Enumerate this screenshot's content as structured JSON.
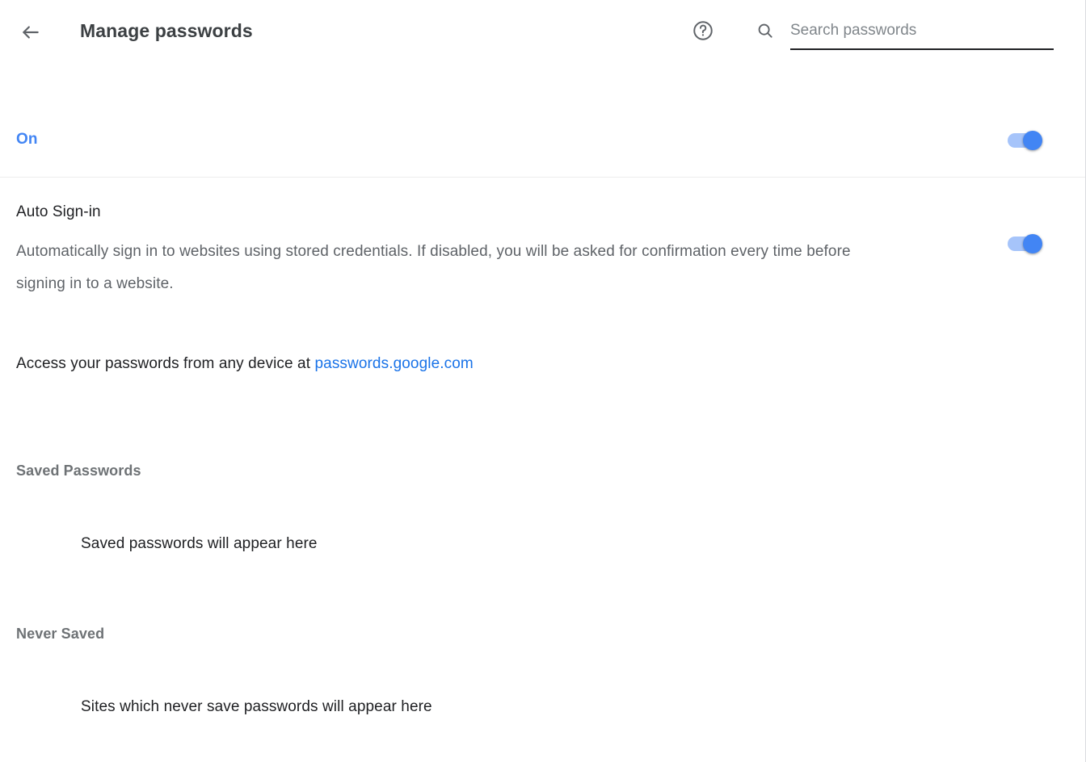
{
  "header": {
    "back_icon": "arrow-back-icon",
    "title": "Manage passwords",
    "help_icon": "help-circle-icon",
    "search": {
      "icon": "search-icon",
      "placeholder": "Search passwords",
      "value": ""
    }
  },
  "offer_to_save": {
    "label": "On",
    "toggle_state": "on"
  },
  "auto_signin": {
    "title": "Auto Sign-in",
    "description": "Automatically sign in to websites using stored credentials. If disabled, you will be asked for confirmation every time before signing in to a website.",
    "toggle_state": "on"
  },
  "access_row": {
    "prefix": "Access your passwords from any device at ",
    "link_text": "passwords.google.com"
  },
  "saved_passwords": {
    "header": "Saved Passwords",
    "empty_text": "Saved passwords will appear here"
  },
  "never_saved": {
    "header": "Never Saved",
    "empty_text": "Sites which never save passwords will appear here"
  },
  "colors": {
    "accent_blue": "#4285f4",
    "link_blue": "#1a73e8",
    "toggle_track": "#a6c4fa",
    "text_primary": "#202124",
    "text_secondary": "#5f6368",
    "section_header": "#6e7275",
    "divider": "#ededed",
    "background": "#ffffff"
  }
}
